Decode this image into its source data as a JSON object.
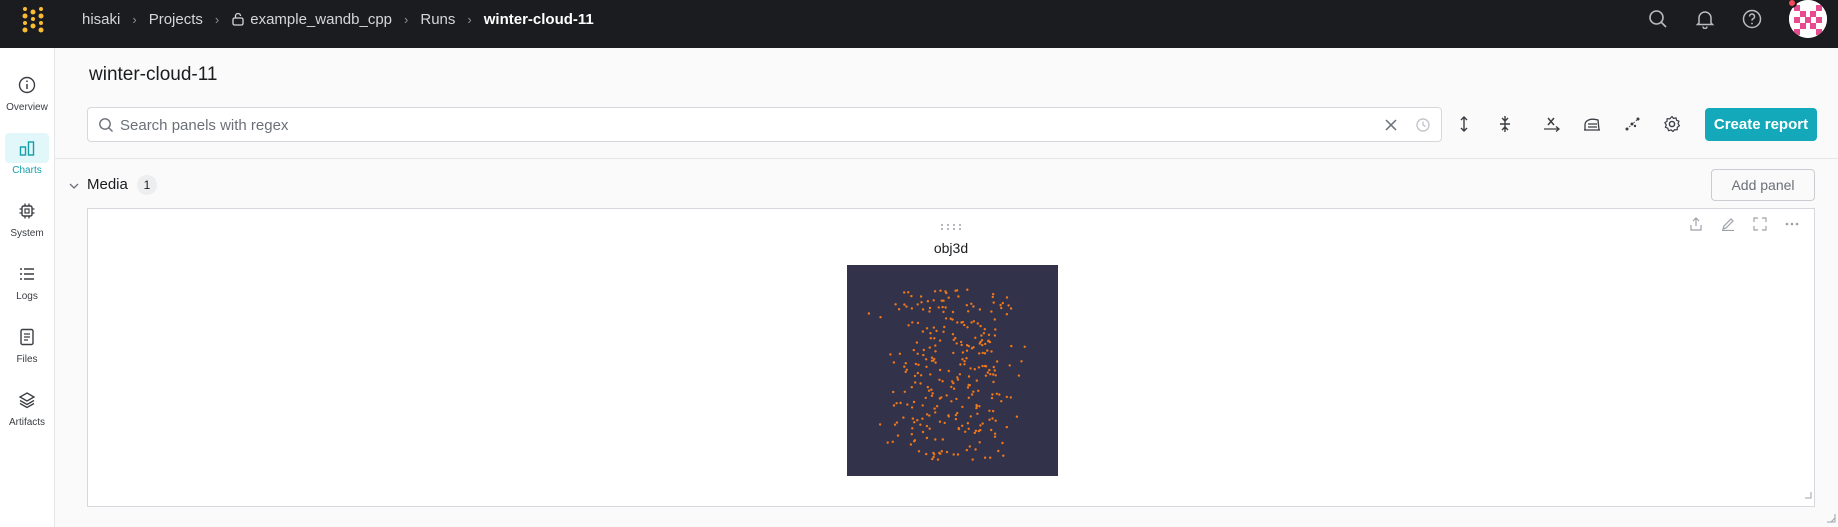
{
  "breadcrumb": {
    "entity": "hisaki",
    "projects": "Projects",
    "project": "example_wandb_cpp",
    "runs": "Runs",
    "run": "winter-cloud-11"
  },
  "topbar_icons": [
    "search-icon",
    "bell-icon",
    "help-icon"
  ],
  "sidebar": {
    "items": [
      {
        "label": "Overview",
        "icon": "info-icon",
        "active": false
      },
      {
        "label": "Charts",
        "icon": "bar-chart-icon",
        "active": true
      },
      {
        "label": "System",
        "icon": "chip-icon",
        "active": false
      },
      {
        "label": "Logs",
        "icon": "list-icon",
        "active": false
      },
      {
        "label": "Files",
        "icon": "file-icon",
        "active": false
      },
      {
        "label": "Artifacts",
        "icon": "layers-icon",
        "active": false
      }
    ]
  },
  "main": {
    "title": "winter-cloud-11",
    "search": {
      "placeholder": "Search panels with regex",
      "value": ""
    },
    "toolbar_icons": [
      "expand-vertical-icon",
      "collapse-vertical-icon",
      "x-axis-icon",
      "smoothing-icon",
      "outliers-icon",
      "settings-icon"
    ],
    "create_report_label": "Create report"
  },
  "section": {
    "title": "Media",
    "count": "1",
    "add_panel_label": "Add panel"
  },
  "panel": {
    "title": "obj3d",
    "actions": [
      "export-icon",
      "edit-icon",
      "fullscreen-icon",
      "more-icon"
    ],
    "viewer_bg": "#33324b",
    "point_color": "#f07818"
  },
  "colors": {
    "topbar": "#1a1c1f",
    "accent": "#13a9ba",
    "sidebar_active": "#119fa9"
  }
}
